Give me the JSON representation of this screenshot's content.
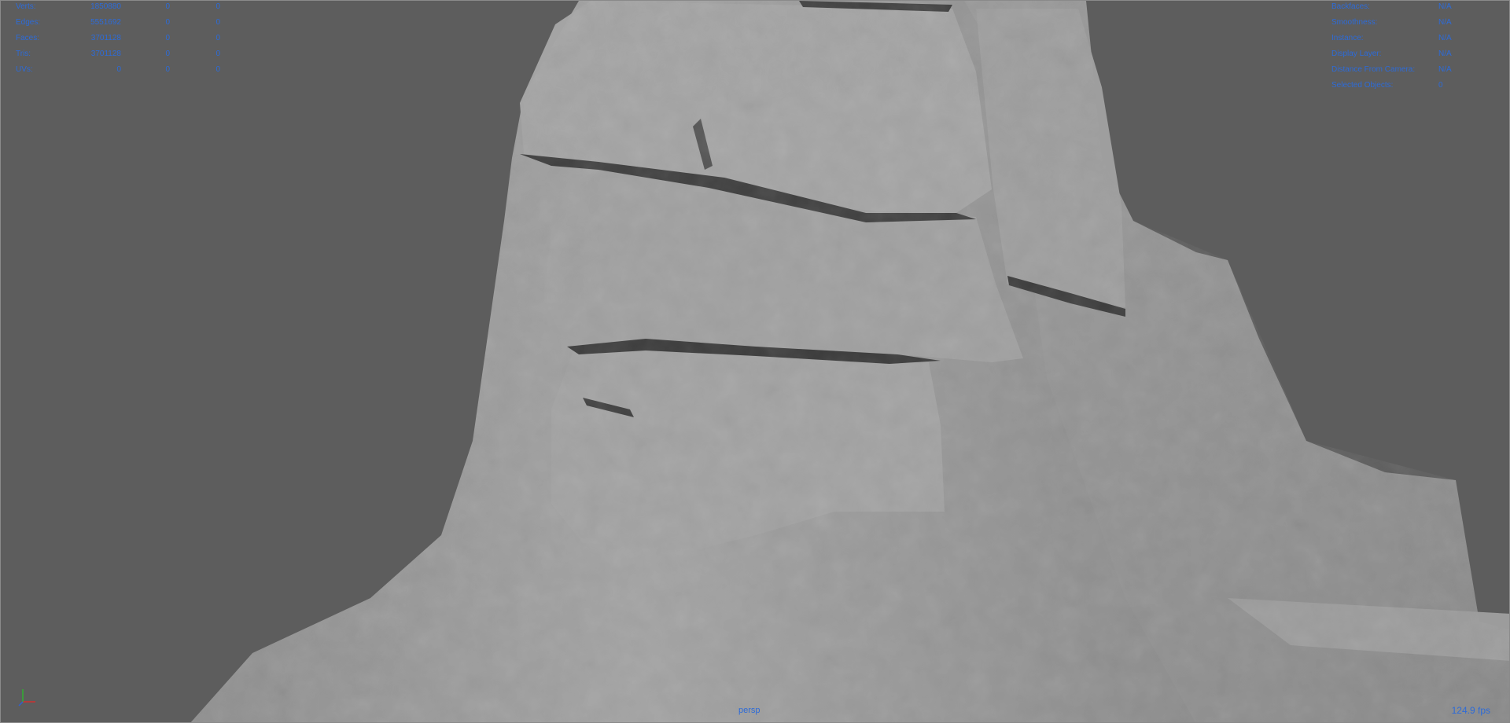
{
  "poly_count": {
    "rows": [
      {
        "label": "Verts:",
        "values": [
          "1850880",
          "0",
          "0"
        ]
      },
      {
        "label": "Edges:",
        "values": [
          "5551692",
          "0",
          "0"
        ]
      },
      {
        "label": "Faces:",
        "values": [
          "3701128",
          "0",
          "0"
        ]
      },
      {
        "label": "Tris:",
        "values": [
          "3701128",
          "0",
          "0"
        ]
      },
      {
        "label": "UVs:",
        "values": [
          "0",
          "0",
          "0"
        ]
      }
    ]
  },
  "object_info": {
    "rows": [
      {
        "label": "Backfaces:",
        "value": "N/A"
      },
      {
        "label": "Smoothness:",
        "value": "N/A"
      },
      {
        "label": "Instance:",
        "value": "N/A"
      },
      {
        "label": "Display Layer:",
        "value": "N/A"
      },
      {
        "label": "Distance From Camera:",
        "value": "N/A"
      },
      {
        "label": "Selected Objects:",
        "value": "0"
      }
    ]
  },
  "viewport": {
    "camera_name": "persp",
    "frame_rate": "124.9 fps",
    "background_color": "#5d5d5d",
    "hud_color": "#2d6bd8"
  }
}
